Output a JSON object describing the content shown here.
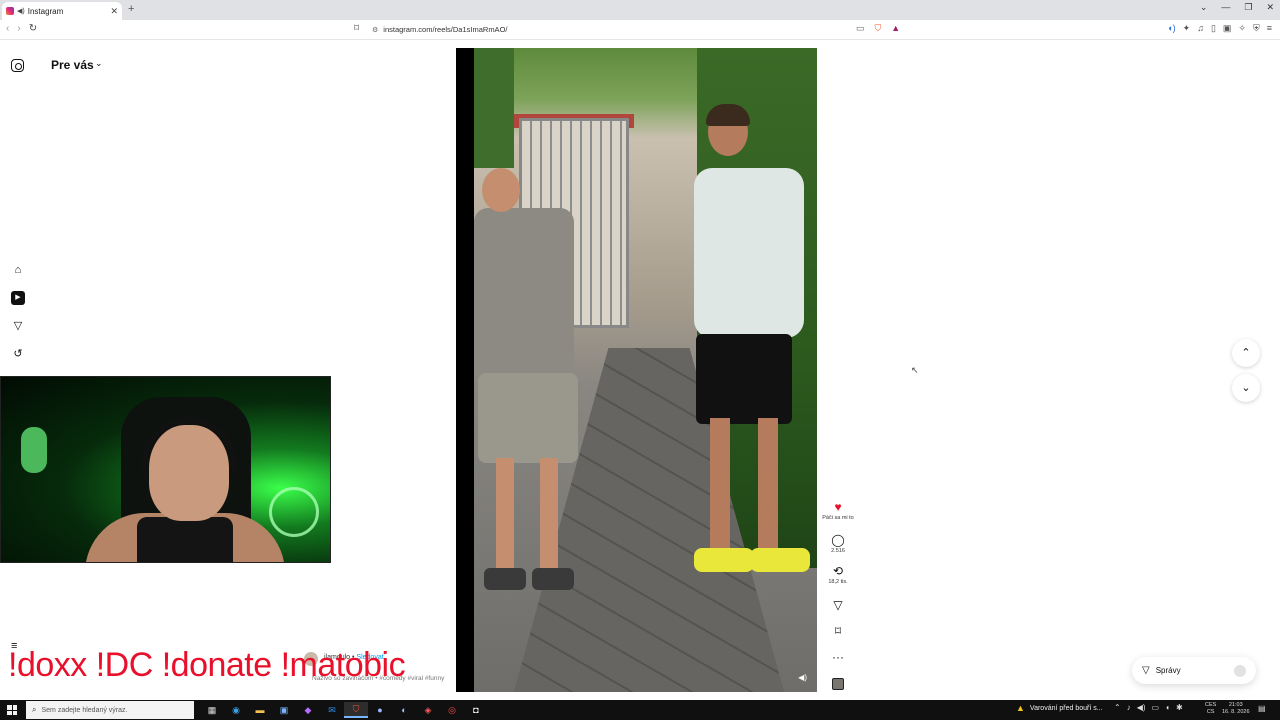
{
  "browser": {
    "tab_title": "Instagram",
    "new_tab": "+",
    "url": "instagram.com/reels/Da1sImaRmAO/",
    "window_controls": [
      "⌄",
      "—",
      "❐",
      "✕"
    ]
  },
  "instagram": {
    "feed_title": "Pre vás",
    "rail_icons": [
      "home-icon",
      "reels-icon",
      "send-icon",
      "activity-icon"
    ],
    "actions": {
      "like_label": "Páči sa mi to",
      "comments_count": "2.516",
      "reposts_count": "18,2 tis.",
      "more": "···"
    },
    "caption": {
      "username": "jlamgulo",
      "separator": " • ",
      "follow": "Sledovať",
      "tags": "Naživo so zavináčom • #comedy #viral #funny"
    },
    "messages_label": "Správy"
  },
  "stream_overlay": {
    "commands": "!doxx  !DC !donate !matobic"
  },
  "taskbar": {
    "search_placeholder": "Sem zadejte hledaný výraz.",
    "notification": "Varování před bouří s...",
    "lang_line1": "CES",
    "lang_line2": "CS",
    "time": "21:03",
    "date": "16. 8. 2026"
  },
  "colors": {
    "like": "#e8102a",
    "overlay_text": "#e8102a",
    "follow": "#0095f6"
  }
}
